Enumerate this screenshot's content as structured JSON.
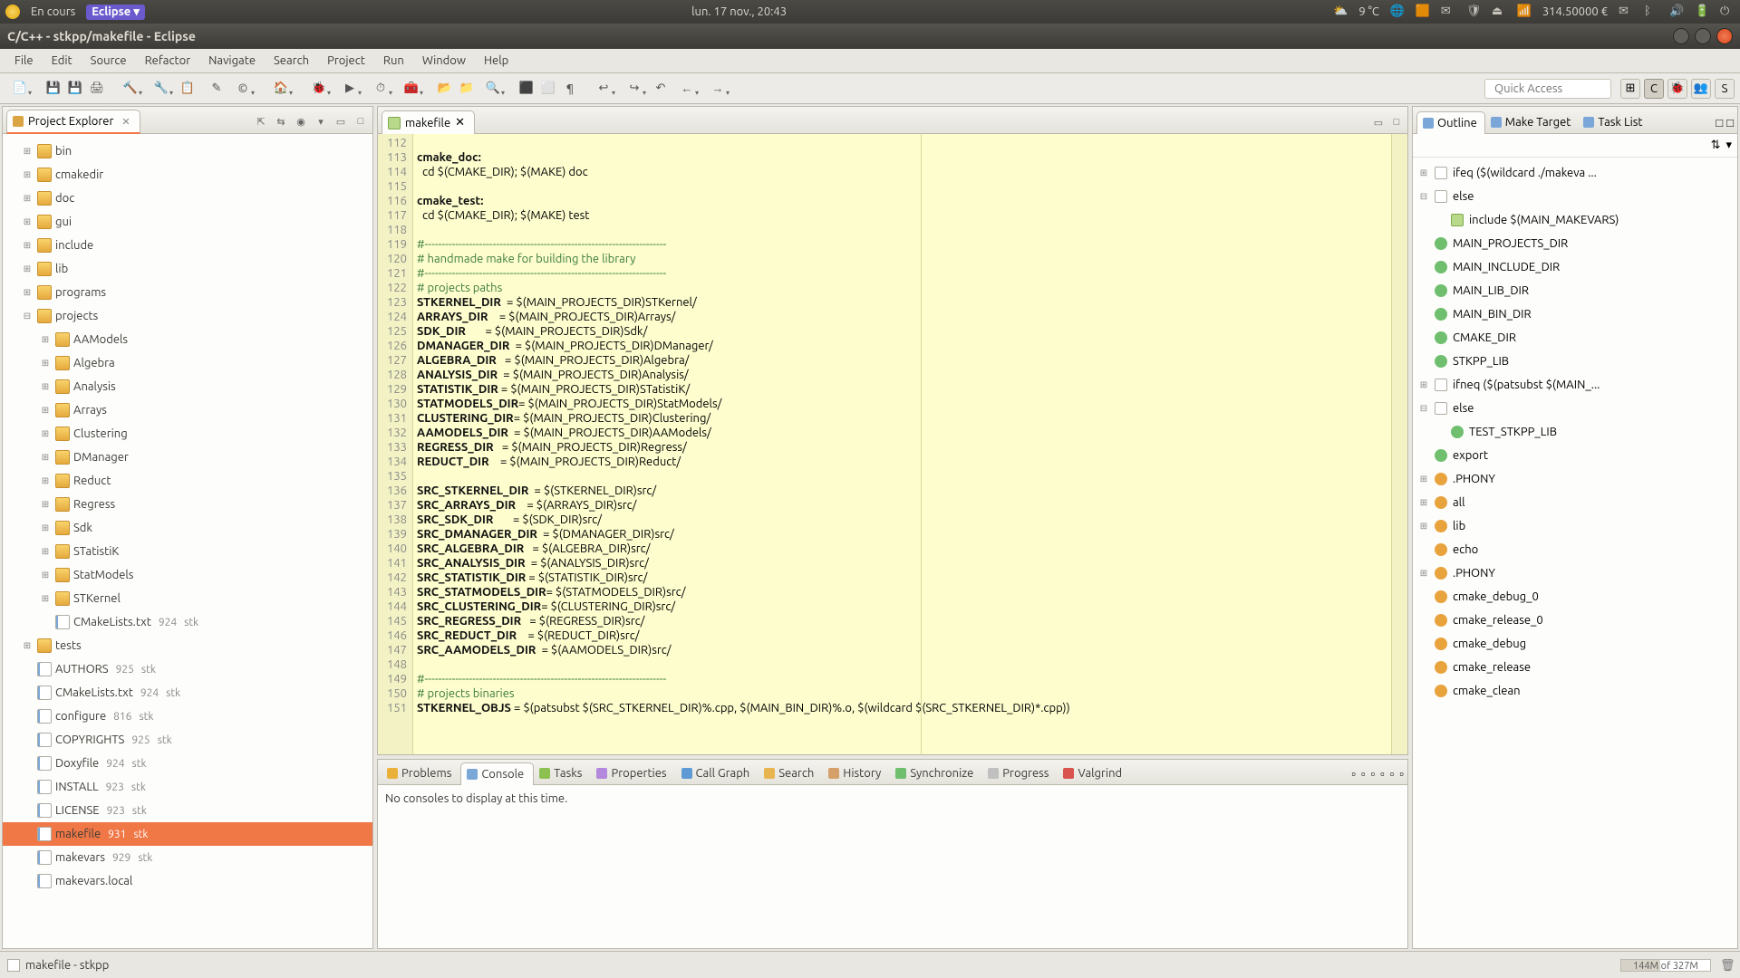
{
  "sysbar": {
    "running": "En cours",
    "app": "Eclipse ▾",
    "datetime": "lun. 17 nov., 20:43",
    "weather": "9 °C",
    "battery": "314.50000 €"
  },
  "titlebar": {
    "title": "C/C++ - stkpp/makefile - Eclipse"
  },
  "menu": [
    "File",
    "Edit",
    "Source",
    "Refactor",
    "Navigate",
    "Search",
    "Project",
    "Run",
    "Window",
    "Help"
  ],
  "quick_access_placeholder": "Quick Access",
  "project_explorer": {
    "title": "Project Explorer",
    "tree": [
      {
        "t": "collapsed",
        "i": "folder",
        "n": "bin",
        "d": 1
      },
      {
        "t": "collapsed",
        "i": "folder",
        "n": "cmakedir",
        "d": 1
      },
      {
        "t": "collapsed",
        "i": "folder",
        "n": "doc",
        "d": 1
      },
      {
        "t": "collapsed",
        "i": "folder",
        "n": "gui",
        "d": 1
      },
      {
        "t": "collapsed",
        "i": "folder",
        "n": "include",
        "d": 1
      },
      {
        "t": "collapsed",
        "i": "folder",
        "n": "lib",
        "d": 1
      },
      {
        "t": "collapsed",
        "i": "folder",
        "n": "programs",
        "d": 1
      },
      {
        "t": "expanded",
        "i": "folder",
        "n": "projects",
        "d": 1
      },
      {
        "t": "collapsed",
        "i": "folder",
        "n": "AAModels",
        "d": 2
      },
      {
        "t": "collapsed",
        "i": "folder",
        "n": "Algebra",
        "d": 2
      },
      {
        "t": "collapsed",
        "i": "folder",
        "n": "Analysis",
        "d": 2
      },
      {
        "t": "collapsed",
        "i": "folder",
        "n": "Arrays",
        "d": 2
      },
      {
        "t": "collapsed",
        "i": "folder",
        "n": "Clustering",
        "d": 2
      },
      {
        "t": "collapsed",
        "i": "folder",
        "n": "DManager",
        "d": 2
      },
      {
        "t": "collapsed",
        "i": "folder",
        "n": "Reduct",
        "d": 2
      },
      {
        "t": "collapsed",
        "i": "folder",
        "n": "Regress",
        "d": 2
      },
      {
        "t": "collapsed",
        "i": "folder",
        "n": "Sdk",
        "d": 2
      },
      {
        "t": "collapsed",
        "i": "folder",
        "n": "STatistiK",
        "d": 2
      },
      {
        "t": "collapsed",
        "i": "folder",
        "n": "StatModels",
        "d": 2
      },
      {
        "t": "collapsed",
        "i": "folder",
        "n": "STKernel",
        "d": 2
      },
      {
        "t": "none",
        "i": "file",
        "n": "CMakeLists.txt",
        "rev": "924",
        "auth": "stk",
        "d": 2
      },
      {
        "t": "collapsed",
        "i": "folder",
        "n": "tests",
        "d": 1
      },
      {
        "t": "none",
        "i": "file",
        "n": "AUTHORS",
        "rev": "925",
        "auth": "stk",
        "d": 1
      },
      {
        "t": "none",
        "i": "file",
        "n": "CMakeLists.txt",
        "rev": "924",
        "auth": "stk",
        "d": 1
      },
      {
        "t": "none",
        "i": "file",
        "n": "configure",
        "rev": "816",
        "auth": "stk",
        "d": 1
      },
      {
        "t": "none",
        "i": "file",
        "n": "COPYRIGHTS",
        "rev": "925",
        "auth": "stk",
        "d": 1
      },
      {
        "t": "none",
        "i": "file",
        "n": "Doxyfile",
        "rev": "924",
        "auth": "stk",
        "d": 1
      },
      {
        "t": "none",
        "i": "file",
        "n": "INSTALL",
        "rev": "923",
        "auth": "stk",
        "d": 1
      },
      {
        "t": "none",
        "i": "file",
        "n": "LICENSE",
        "rev": "923",
        "auth": "stk",
        "d": 1
      },
      {
        "t": "none",
        "i": "file",
        "n": "makefile",
        "rev": "931",
        "auth": "stk",
        "d": 1,
        "sel": true
      },
      {
        "t": "none",
        "i": "file",
        "n": "makevars",
        "rev": "929",
        "auth": "stk",
        "d": 1
      },
      {
        "t": "none",
        "i": "file",
        "n": "makevars.local",
        "d": 1
      }
    ]
  },
  "editor": {
    "tab": "makefile",
    "first_line": 112,
    "lines": [
      {
        "n": 112,
        "txt": ""
      },
      {
        "n": 113,
        "txt": "cmake_doc:",
        "cls": "kw"
      },
      {
        "n": 114,
        "txt": "  cd $(CMAKE_DIR); $(MAKE) doc"
      },
      {
        "n": 115,
        "txt": ""
      },
      {
        "n": 116,
        "txt": "cmake_test:",
        "cls": "kw"
      },
      {
        "n": 117,
        "txt": "  cd $(CMAKE_DIR); $(MAKE) test"
      },
      {
        "n": 118,
        "txt": ""
      },
      {
        "n": 119,
        "txt": "#-----------------------------------------------------------------------",
        "cls": "cmt"
      },
      {
        "n": 120,
        "txt": "# handmade make for building the library",
        "cls": "cmt"
      },
      {
        "n": 121,
        "txt": "#-----------------------------------------------------------------------",
        "cls": "cmt"
      },
      {
        "n": 122,
        "txt": "# projects paths",
        "cls": "cmt"
      },
      {
        "n": 123,
        "txt": "STKERNEL_DIR  = $(MAIN_PROJECTS_DIR)STKernel/",
        "kw": "STKERNEL_DIR"
      },
      {
        "n": 124,
        "txt": "ARRAYS_DIR    = $(MAIN_PROJECTS_DIR)Arrays/",
        "kw": "ARRAYS_DIR"
      },
      {
        "n": 125,
        "txt": "SDK_DIR       = $(MAIN_PROJECTS_DIR)Sdk/",
        "kw": "SDK_DIR"
      },
      {
        "n": 126,
        "txt": "DMANAGER_DIR  = $(MAIN_PROJECTS_DIR)DManager/",
        "kw": "DMANAGER_DIR"
      },
      {
        "n": 127,
        "txt": "ALGEBRA_DIR   = $(MAIN_PROJECTS_DIR)Algebra/",
        "kw": "ALGEBRA_DIR"
      },
      {
        "n": 128,
        "txt": "ANALYSIS_DIR  = $(MAIN_PROJECTS_DIR)Analysis/",
        "kw": "ANALYSIS_DIR"
      },
      {
        "n": 129,
        "txt": "STATISTIK_DIR = $(MAIN_PROJECTS_DIR)STatistiK/",
        "kw": "STATISTIK_DIR"
      },
      {
        "n": 130,
        "txt": "STATMODELS_DIR= $(MAIN_PROJECTS_DIR)StatModels/",
        "kw": "STATMODELS_DIR"
      },
      {
        "n": 131,
        "txt": "CLUSTERING_DIR= $(MAIN_PROJECTS_DIR)Clustering/",
        "kw": "CLUSTERING_DIR"
      },
      {
        "n": 132,
        "txt": "AAMODELS_DIR  = $(MAIN_PROJECTS_DIR)AAModels/",
        "kw": "AAMODELS_DIR"
      },
      {
        "n": 133,
        "txt": "REGRESS_DIR   = $(MAIN_PROJECTS_DIR)Regress/",
        "kw": "REGRESS_DIR"
      },
      {
        "n": 134,
        "txt": "REDUCT_DIR    = $(MAIN_PROJECTS_DIR)Reduct/",
        "kw": "REDUCT_DIR"
      },
      {
        "n": 135,
        "txt": ""
      },
      {
        "n": 136,
        "txt": "SRC_STKERNEL_DIR  = $(STKERNEL_DIR)src/",
        "kw": "SRC_STKERNEL_DIR"
      },
      {
        "n": 137,
        "txt": "SRC_ARRAYS_DIR    = $(ARRAYS_DIR)src/",
        "kw": "SRC_ARRAYS_DIR"
      },
      {
        "n": 138,
        "txt": "SRC_SDK_DIR       = $(SDK_DIR)src/",
        "kw": "SRC_SDK_DIR"
      },
      {
        "n": 139,
        "txt": "SRC_DMANAGER_DIR  = $(DMANAGER_DIR)src/",
        "kw": "SRC_DMANAGER_DIR"
      },
      {
        "n": 140,
        "txt": "SRC_ALGEBRA_DIR   = $(ALGEBRA_DIR)src/",
        "kw": "SRC_ALGEBRA_DIR"
      },
      {
        "n": 141,
        "txt": "SRC_ANALYSIS_DIR  = $(ANALYSIS_DIR)src/",
        "kw": "SRC_ANALYSIS_DIR"
      },
      {
        "n": 142,
        "txt": "SRC_STATISTIK_DIR = $(STATISTIK_DIR)src/",
        "kw": "SRC_STATISTIK_DIR"
      },
      {
        "n": 143,
        "txt": "SRC_STATMODELS_DIR= $(STATMODELS_DIR)src/",
        "kw": "SRC_STATMODELS_DIR"
      },
      {
        "n": 144,
        "txt": "SRC_CLUSTERING_DIR= $(CLUSTERING_DIR)src/",
        "kw": "SRC_CLUSTERING_DIR"
      },
      {
        "n": 145,
        "txt": "SRC_REGRESS_DIR   = $(REGRESS_DIR)src/",
        "kw": "SRC_REGRESS_DIR"
      },
      {
        "n": 146,
        "txt": "SRC_REDUCT_DIR    = $(REDUCT_DIR)src/",
        "kw": "SRC_REDUCT_DIR"
      },
      {
        "n": 147,
        "txt": "SRC_AAMODELS_DIR  = $(AAMODELS_DIR)src/",
        "kw": "SRC_AAMODELS_DIR"
      },
      {
        "n": 148,
        "txt": ""
      },
      {
        "n": 149,
        "txt": "#-----------------------------------------------------------------------",
        "cls": "cmt"
      },
      {
        "n": 150,
        "txt": "# projects binaries",
        "cls": "cmt"
      },
      {
        "n": 151,
        "txt": "STKERNEL_OBJS = $(patsubst $(SRC_STKERNEL_DIR)%.cpp, $(MAIN_BIN_DIR)%.o, $(wildcard $(SRC_STKERNEL_DIR)*.cpp))",
        "kw": "STKERNEL_OBJS"
      }
    ]
  },
  "outline": {
    "tabs": [
      "Outline",
      "Make Target",
      "Task List"
    ],
    "items": [
      {
        "tw": "⊞",
        "ic": "file",
        "n": "ifeq ($(wildcard ./makeva ..."
      },
      {
        "tw": "⊟",
        "ic": "file",
        "n": "else"
      },
      {
        "tw": "",
        "ic": "inc",
        "n": "include $(MAIN_MAKEVARS)",
        "d": 1
      },
      {
        "tw": "",
        "ic": "gr",
        "n": "MAIN_PROJECTS_DIR"
      },
      {
        "tw": "",
        "ic": "gr",
        "n": "MAIN_INCLUDE_DIR"
      },
      {
        "tw": "",
        "ic": "gr",
        "n": "MAIN_LIB_DIR"
      },
      {
        "tw": "",
        "ic": "gr",
        "n": "MAIN_BIN_DIR"
      },
      {
        "tw": "",
        "ic": "gr",
        "n": "CMAKE_DIR"
      },
      {
        "tw": "",
        "ic": "gr",
        "n": "STKPP_LIB"
      },
      {
        "tw": "⊞",
        "ic": "file",
        "n": "ifneq ($(patsubst $(MAIN_..."
      },
      {
        "tw": "⊟",
        "ic": "file",
        "n": "else"
      },
      {
        "tw": "",
        "ic": "gr",
        "n": "TEST_STKPP_LIB",
        "d": 1
      },
      {
        "tw": "",
        "ic": "gr",
        "n": "export"
      },
      {
        "tw": "⊞",
        "ic": "or",
        "n": ".PHONY"
      },
      {
        "tw": "⊞",
        "ic": "or",
        "n": "all"
      },
      {
        "tw": "⊞",
        "ic": "or",
        "n": "lib"
      },
      {
        "tw": "",
        "ic": "or",
        "n": "echo"
      },
      {
        "tw": "⊞",
        "ic": "or",
        "n": ".PHONY"
      },
      {
        "tw": "",
        "ic": "or",
        "n": "cmake_debug_0"
      },
      {
        "tw": "",
        "ic": "or",
        "n": "cmake_release_0"
      },
      {
        "tw": "",
        "ic": "or",
        "n": "cmake_debug"
      },
      {
        "tw": "",
        "ic": "or",
        "n": "cmake_release"
      },
      {
        "tw": "",
        "ic": "or",
        "n": "cmake_clean"
      }
    ]
  },
  "bottom": {
    "tabs": [
      "Problems",
      "Console",
      "Tasks",
      "Properties",
      "Call Graph",
      "Search",
      "History",
      "Synchronize",
      "Progress",
      "Valgrind"
    ],
    "active": 1,
    "console_msg": "No consoles to display at this time."
  },
  "statusbar": {
    "left": "makefile - stkpp",
    "heap": "144M of 327M"
  }
}
